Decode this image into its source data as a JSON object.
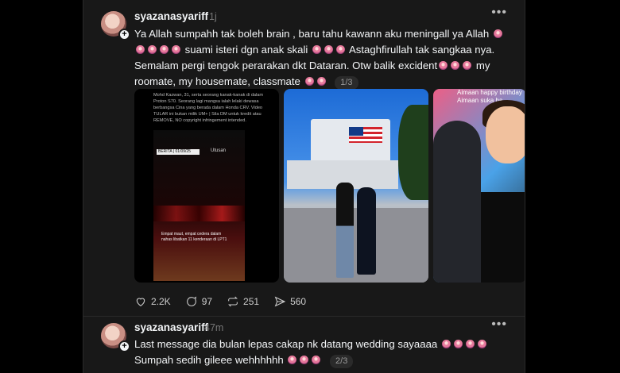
{
  "posts": [
    {
      "username": "syazanasyariff",
      "time": "1j",
      "text_lines": [
        "Ya Allah sumpahh tak boleh brain , baru tahu kawann aku meningall ya Allah",
        "suami isteri dgn anak skali",
        "Astaghfirullah tak sangkaa nya.",
        "Semalam pergi tengok perarakan dkt Dataran. Otw balik excident",
        "my",
        "roomate, my housemate, classmate"
      ],
      "page_indicator": "1/3",
      "images": [
        {
          "caption": "Mohd Kazwan, 31, serta seorang kanak-kanak di dalam Proton S70. Seorang lagi mangsa ialah lelaki dewasa berbangsa Cina yang berada dalam Honda CRV. Video TULAR ini bukan milik UM+ | Sila DM untuk kredit atau REMOVE, NO copyright infringement intended.",
          "video_tag": "BERITA | 01/09/25",
          "video_logo": "Utusan",
          "video_caption": "Empat maut, empat cedera dalam nahas libatkan 11 kenderaan di LPT1"
        },
        {},
        {
          "overlay_text": "Aimaan happy birthday Aimaan suka ha"
        }
      ],
      "actions": {
        "likes": "2.2K",
        "comments": "97",
        "reposts": "251",
        "shares": "560"
      }
    },
    {
      "username": "syazanasyariff",
      "time": "47m",
      "text_lines": [
        "Last message dia bulan lepas cakap nk datang wedding sayaaaa",
        "Sumpah sedih gileee wehhhhhh"
      ],
      "page_indicator": "2/3"
    }
  ],
  "icons": {
    "more": "more-horizontal-icon",
    "like": "heart-icon",
    "comment": "comment-icon",
    "repost": "repost-icon",
    "share": "send-icon",
    "follow": "plus-icon"
  },
  "colors": {
    "background": "#101010",
    "card": "#181818",
    "text": "#f3f5f7",
    "muted": "#777777"
  }
}
